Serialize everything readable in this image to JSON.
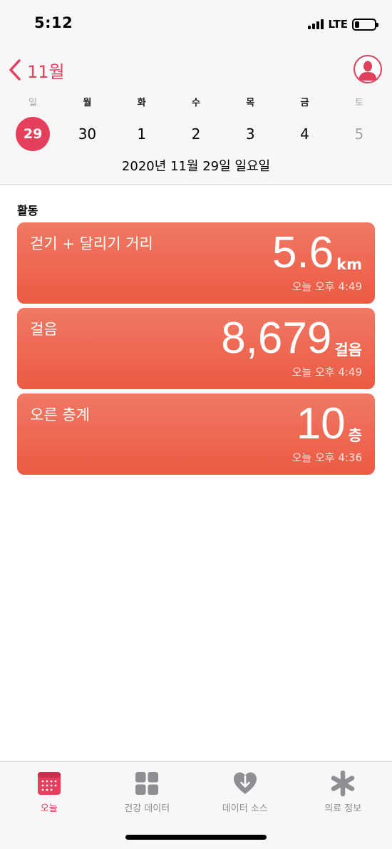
{
  "status_bar": {
    "time": "5:12",
    "network": "LTE"
  },
  "header": {
    "back_label": "11월"
  },
  "week": {
    "weekdays": [
      "일",
      "월",
      "화",
      "수",
      "목",
      "금",
      "토"
    ],
    "days": [
      "29",
      "30",
      "1",
      "2",
      "3",
      "4",
      "5"
    ],
    "selected_index": 0,
    "full_date": "2020년 11월 29일 일요일"
  },
  "activity": {
    "section_title": "활동",
    "cards": [
      {
        "title": "걷기 + 달리기 거리",
        "value": "5.6",
        "unit": "km",
        "time": "오늘 오후 4:49"
      },
      {
        "title": "걸음",
        "value": "8,679",
        "unit": "걸음",
        "time": "오늘 오후 4:49"
      },
      {
        "title": "오른 층계",
        "value": "10",
        "unit": "층",
        "time": "오늘 오후 4:36"
      }
    ]
  },
  "tabs": [
    {
      "label": "오늘",
      "icon": "calendar-icon",
      "active": true
    },
    {
      "label": "건강 데이터",
      "icon": "grid-icon",
      "active": false
    },
    {
      "label": "데이터 소스",
      "icon": "heart-download-icon",
      "active": false
    },
    {
      "label": "의료 정보",
      "icon": "asterisk-icon",
      "active": false
    }
  ],
  "colors": {
    "accent": "#e2405d",
    "card": "#ec5a44",
    "inactive_tab": "#8e8e93"
  }
}
